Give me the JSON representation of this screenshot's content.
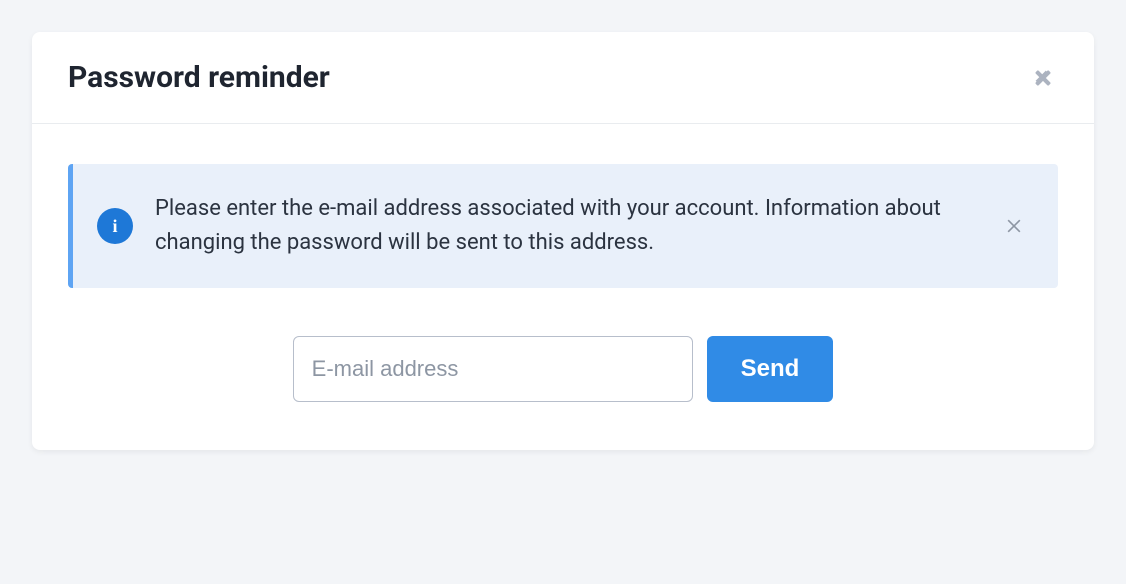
{
  "modal": {
    "title": "Password reminder",
    "alert": {
      "icon_label": "i",
      "message": "Please enter the e-mail address associated with your account. Information about changing the password will be sent to this address."
    },
    "form": {
      "email_placeholder": "E-mail address",
      "email_value": "",
      "send_label": "Send"
    }
  }
}
